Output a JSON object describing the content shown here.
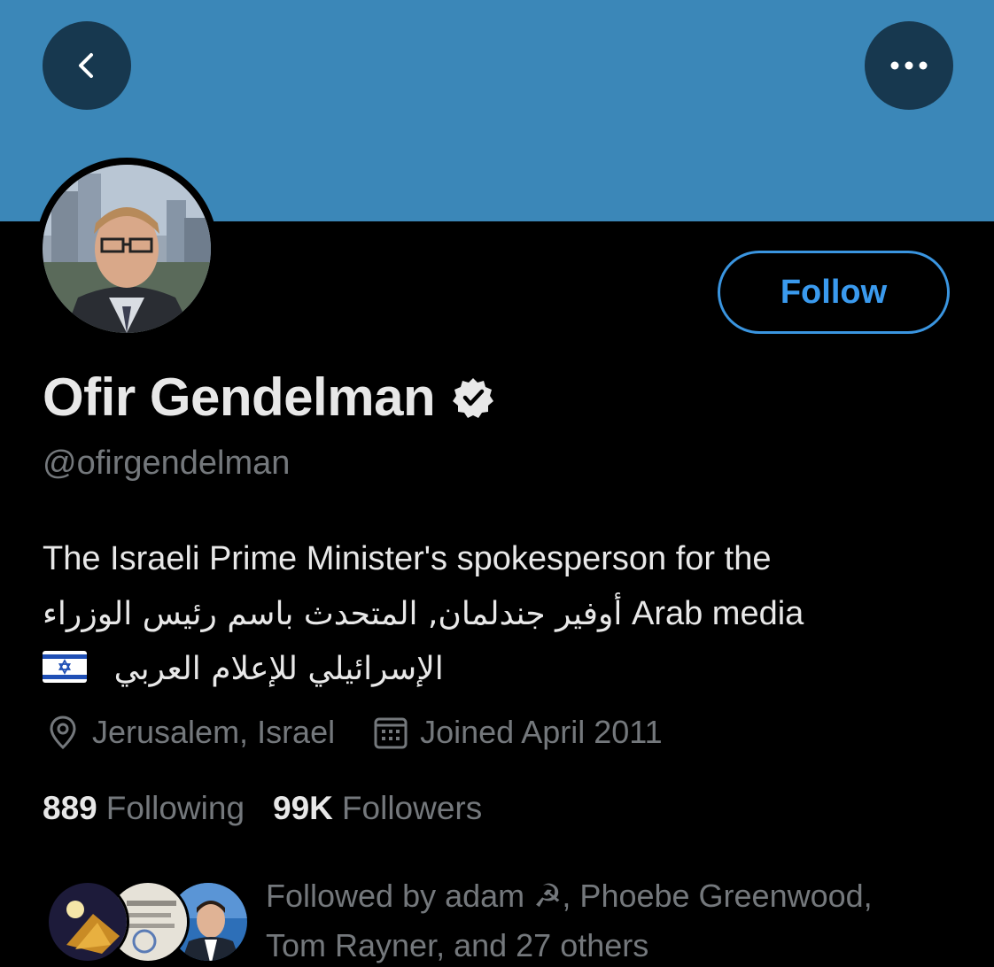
{
  "header": {
    "back_icon": "chevron-left-icon",
    "more_icon": "more-horizontal-icon",
    "banner_color": "#3b87b8"
  },
  "profile": {
    "display_name": "Ofir Gendelman",
    "verified_icon": "verified-badge-icon",
    "handle": "@ofirgendelman",
    "follow_label": "Follow",
    "bio": {
      "line1": "The Israeli Prime Minister's spokesperson for the",
      "line2_latin": "Arab media",
      "line2_arabic": "أوفير جندلمان, المتحدث باسم رئيس الوزراء",
      "line3_arabic": "الإسرائيلي للإعلام العربي",
      "flag_icon": "israel-flag-icon"
    },
    "location": "Jerusalem, Israel",
    "joined": "Joined April 2011",
    "following_count": "889",
    "following_label": "Following",
    "followers_count": "99K",
    "followers_label": "Followers"
  },
  "followed_by": {
    "line1": "Followed by adam ☭, Phoebe Greenwood,",
    "line2": "Tom Rayner, and 27 others"
  },
  "colors": {
    "accent": "#3a9aee",
    "muted_text": "#74787c",
    "primary_text": "#e8e8e8"
  }
}
